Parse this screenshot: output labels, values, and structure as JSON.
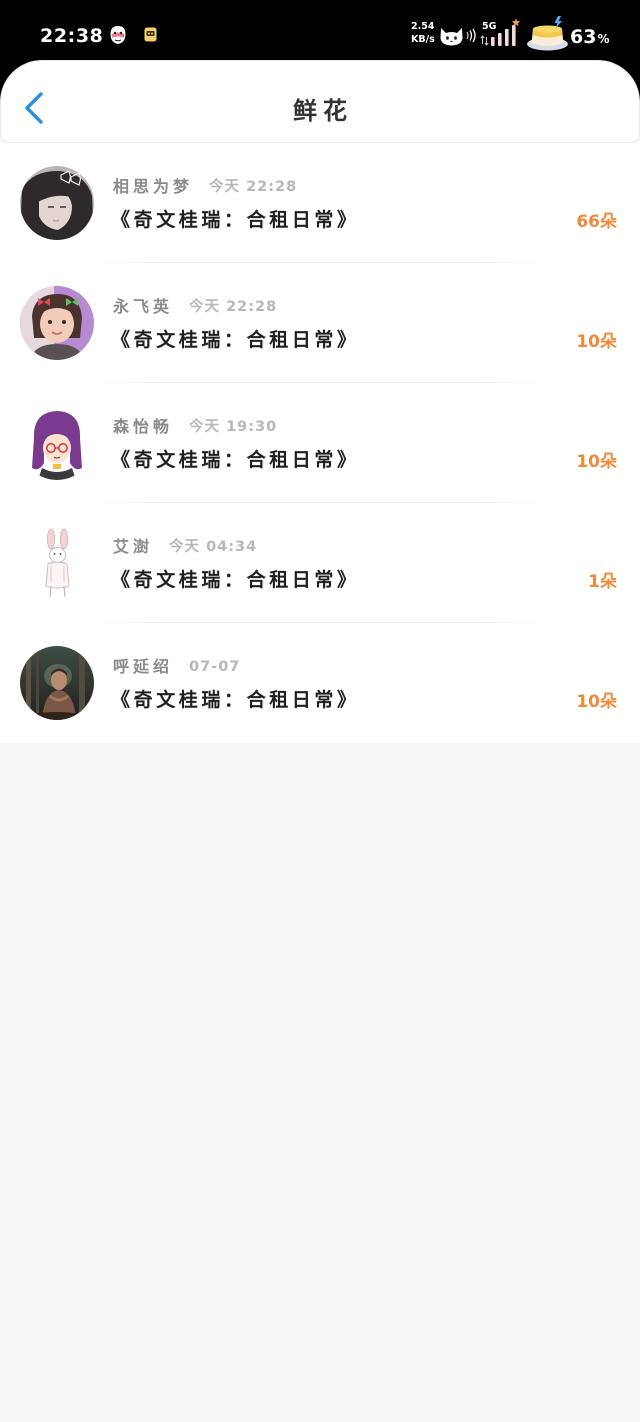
{
  "status_bar": {
    "time": "22:38",
    "net_speed": "2.54",
    "net_speed_unit": "KB/s",
    "network_type": "5G",
    "battery_level": "63",
    "battery_unit": "%",
    "icons": [
      "mask-face-icon",
      "notification-app-icon",
      "cat-icon",
      "vibration-icon",
      "data-activity-icon",
      "cellular-signal-icon",
      "battery-icon"
    ]
  },
  "header": {
    "title": "鲜花",
    "back_icon": "chevron-left-icon"
  },
  "colors": {
    "accent": "#2a8fe3",
    "flower_count": "#ee8a3a",
    "username": "#8a8a8a",
    "time": "#b7b7b7",
    "book_title": "#202020",
    "page_background": "#f8f6f7"
  },
  "list": {
    "items": [
      {
        "username": "相思为梦",
        "time": "今天 22:28",
        "book_title": "《奇文桂瑞：合租日常》",
        "flowers": "66朵"
      },
      {
        "username": "永飞英",
        "time": "今天 22:28",
        "book_title": "《奇文桂瑞：合租日常》",
        "flowers": "10朵"
      },
      {
        "username": "森怡畅",
        "time": "今天 19:30",
        "book_title": "《奇文桂瑞：合租日常》",
        "flowers": "10朵"
      },
      {
        "username": "艾澍",
        "time": "今天 04:34",
        "book_title": "《奇文桂瑞：合租日常》",
        "flowers": "1朵"
      },
      {
        "username": "呼延绍",
        "time": "07-07",
        "book_title": "《奇文桂瑞：合租日常》",
        "flowers": "10朵"
      }
    ]
  }
}
